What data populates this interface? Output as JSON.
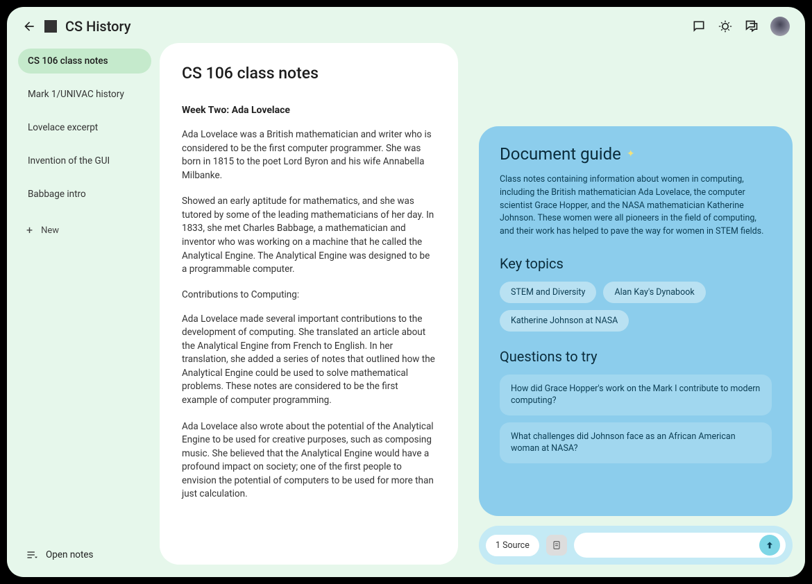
{
  "header": {
    "title": "CS History"
  },
  "sidebar": {
    "items": [
      {
        "label": "CS 106 class notes",
        "active": true
      },
      {
        "label": "Mark 1/UNIVAC history",
        "active": false
      },
      {
        "label": "Lovelace excerpt",
        "active": false
      },
      {
        "label": "Invention of the GUI",
        "active": false
      },
      {
        "label": "Babbage intro",
        "active": false
      }
    ],
    "new_label": "New",
    "open_notes_label": "Open notes"
  },
  "document": {
    "title": "CS 106 class notes",
    "section_heading": "Week Two: Ada Lovelace",
    "paragraphs": [
      "Ada Lovelace was a British mathematician and writer who is considered to be the first computer programmer. She was born in 1815 to the poet Lord Byron and his wife Annabella Milbanke.",
      "Showed an early aptitude for mathematics, and she was tutored by some of the leading mathematicians of her day. In 1833, she met Charles Babbage, a mathematician and inventor who was working on a machine that he called the Analytical Engine. The Analytical Engine was designed to be a programmable computer."
    ],
    "subheading": "Contributions to Computing:",
    "paragraphs2": [
      "Ada Lovelace made several important contributions to the development of computing. She translated an article about the Analytical Engine from French to English. In her translation, she added a series of notes that outlined how the Analytical Engine could be used to solve mathematical problems. These notes are considered to be the first example of computer programming.",
      "Ada Lovelace also wrote about the potential of the Analytical Engine to be used for creative purposes, such as composing music. She believed that the Analytical Engine would have a profound impact on society; one of the first people to envision the potential of computers to be used for more than just calculation."
    ]
  },
  "guide": {
    "title": "Document guide",
    "description": "Class notes containing information about women in computing, including the British mathematician Ada Lovelace, the computer scientist Grace Hopper, and the NASA mathematician Katherine Johnson. These women were all pioneers in the field of computing, and their work has helped to pave the way for women in STEM fields.",
    "key_topics_title": "Key topics",
    "topics": [
      "STEM and Diversity",
      "Alan Kay's Dynabook",
      "Katherine Johnson at NASA"
    ],
    "questions_title": "Questions to try",
    "questions": [
      "How did Grace Hopper's work on the Mark I contribute to modern computing?",
      "What challenges did Johnson face as an African American woman at NASA?"
    ]
  },
  "chat": {
    "source_label": "1 Source",
    "input_placeholder": ""
  }
}
